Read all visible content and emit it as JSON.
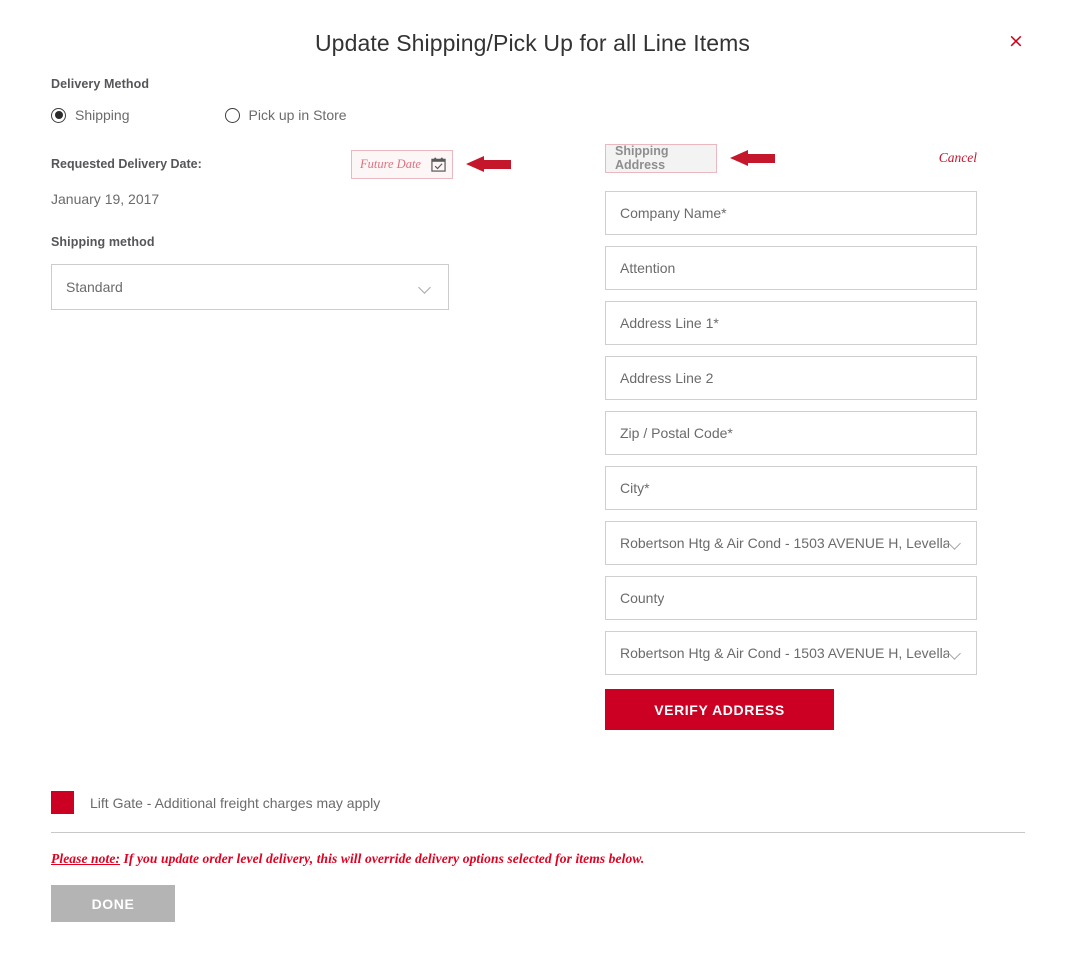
{
  "modal": {
    "title": "Update Shipping/Pick Up for all Line Items",
    "close_label": "×"
  },
  "delivery": {
    "section_label": "Delivery Method",
    "options": [
      {
        "label": "Shipping",
        "selected": true
      },
      {
        "label": "Pick up in Store",
        "selected": false
      }
    ]
  },
  "requested_delivery": {
    "label": "Requested Delivery Date:",
    "date_placeholder": "Future Date",
    "current_date": "January 19, 2017",
    "calendar_icon": "calendar-check-icon",
    "arrow_icon": "left-arrow-annotation"
  },
  "shipping_method": {
    "label": "Shipping method",
    "selected": "Standard",
    "chevron_icon": "chevron-down-icon"
  },
  "address": {
    "panel_title": "Shipping Address",
    "cancel_label": "Cancel",
    "arrow_icon": "left-arrow-annotation",
    "fields": [
      {
        "placeholder": "Company Name*",
        "name": "company-name-field",
        "type": "text"
      },
      {
        "placeholder": "Attention",
        "name": "attention-field",
        "type": "text"
      },
      {
        "placeholder": "Address Line 1*",
        "name": "address-line-1-field",
        "type": "text"
      },
      {
        "placeholder": "Address Line 2",
        "name": "address-line-2-field",
        "type": "text"
      },
      {
        "placeholder": "Zip / Postal Code*",
        "name": "zip-postal-code-field",
        "type": "text"
      },
      {
        "placeholder": "City*",
        "name": "city-field",
        "type": "text"
      },
      {
        "placeholder": "Robertson Htg & Air Cond - 1503 AVENUE H, Levella...",
        "name": "state-dropdown",
        "type": "dropdown"
      },
      {
        "placeholder": "County",
        "name": "county-field",
        "type": "text"
      },
      {
        "placeholder": "Robertson Htg & Air Cond - 1503 AVENUE H, Levella...",
        "name": "country-dropdown",
        "type": "dropdown"
      }
    ],
    "verify_button": "VERIFY ADDRESS"
  },
  "footer": {
    "liftgate_label": "Lift Gate - Additional freight charges may apply",
    "liftgate_checked": true,
    "note_prefix": "Please note:",
    "note_body": " If you update order level delivery, this will override delivery options selected for items below.",
    "done_label": "DONE"
  },
  "colors": {
    "brand_red": "#cc0022",
    "annotation_red": "#c4172c",
    "note_red": "#e00020",
    "disabled_gray": "#b4b4b4"
  }
}
